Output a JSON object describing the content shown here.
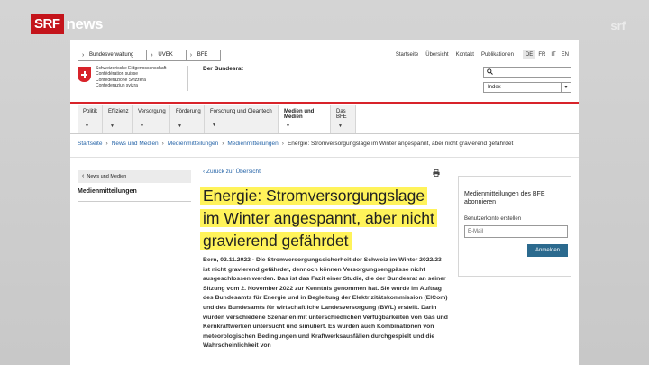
{
  "broadcast": {
    "brand": "SRF",
    "channel": "news",
    "watermark": "srf"
  },
  "site": {
    "top_breadcrumb": [
      "Bundesverwaltung",
      "UVEK",
      "BFE"
    ],
    "top_links": [
      "Startseite",
      "Übersicht",
      "Kontakt",
      "Publikationen"
    ],
    "languages": [
      "DE",
      "FR",
      "IT",
      "EN"
    ],
    "active_language": "DE",
    "confederation_lines": [
      "Schweizerische Eidgenossenschaft",
      "Confédération suisse",
      "Confederazione Svizzera",
      "Confederaziun svizra"
    ],
    "department": "Der Bundesrat",
    "search_placeholder": "",
    "index_select": "Index",
    "nav": [
      {
        "label": "Politik"
      },
      {
        "label": "Effizienz"
      },
      {
        "label": "Versorgung"
      },
      {
        "label": "Förderung"
      },
      {
        "label": "Forschung und Cleantech"
      },
      {
        "label": "Medien und Medien"
      },
      {
        "label": "Das BFE"
      }
    ],
    "path": [
      "Startseite",
      "News und Medien",
      "Medienmitteilungen",
      "Medienmitteilungen"
    ],
    "path_current": "Energie: Stromversorgungslage im Winter angespannt, aber nicht gravierend gefährdet"
  },
  "sidebar": {
    "back_label": "News und Medien",
    "current_label": "Medienmitteilungen"
  },
  "article": {
    "back_link": "Zurück zur Übersicht",
    "title": "Energie: Stromversorgungslage im Winter angespannt, aber nicht gravierend gefährdet",
    "body": "Bern, 02.11.2022 - Die Stromversorgungssicherheit der Schweiz im Winter 2022/23 ist nicht gravierend gefährdet, dennoch können Versorgungsengpässe nicht ausgeschlossen werden. Das ist das Fazit einer Studie, die der Bundesrat an seiner Sitzung vom 2. November 2022 zur Kenntnis genommen hat. Sie wurde im Auftrag des Bundesamts für Energie und in Begleitung der Elektrizitätskommission (ElCom) und des Bundesamts für wirtschaftliche Landesversorgung (BWL) erstellt. Darin wurden verschiedene Szenarien mit unterschiedlichen Verfügbarkeiten von Gas und Kernkraftwerken untersucht und simuliert. Es wurden auch Kombinationen von meteorologischen Bedingungen und Kraftwerksausfällen durchgespielt und die Wahrscheinlichkeit von"
  },
  "subscribe": {
    "title": "Medienmitteilungen des BFE abonnieren",
    "label": "Benutzerkonto erstellen",
    "email_placeholder": "E-Mail",
    "button": "Anmelden"
  },
  "colors": {
    "accent_red": "#d8232a",
    "link_blue": "#2765a8",
    "highlight": "#fff35a",
    "button": "#2b6a8e"
  }
}
